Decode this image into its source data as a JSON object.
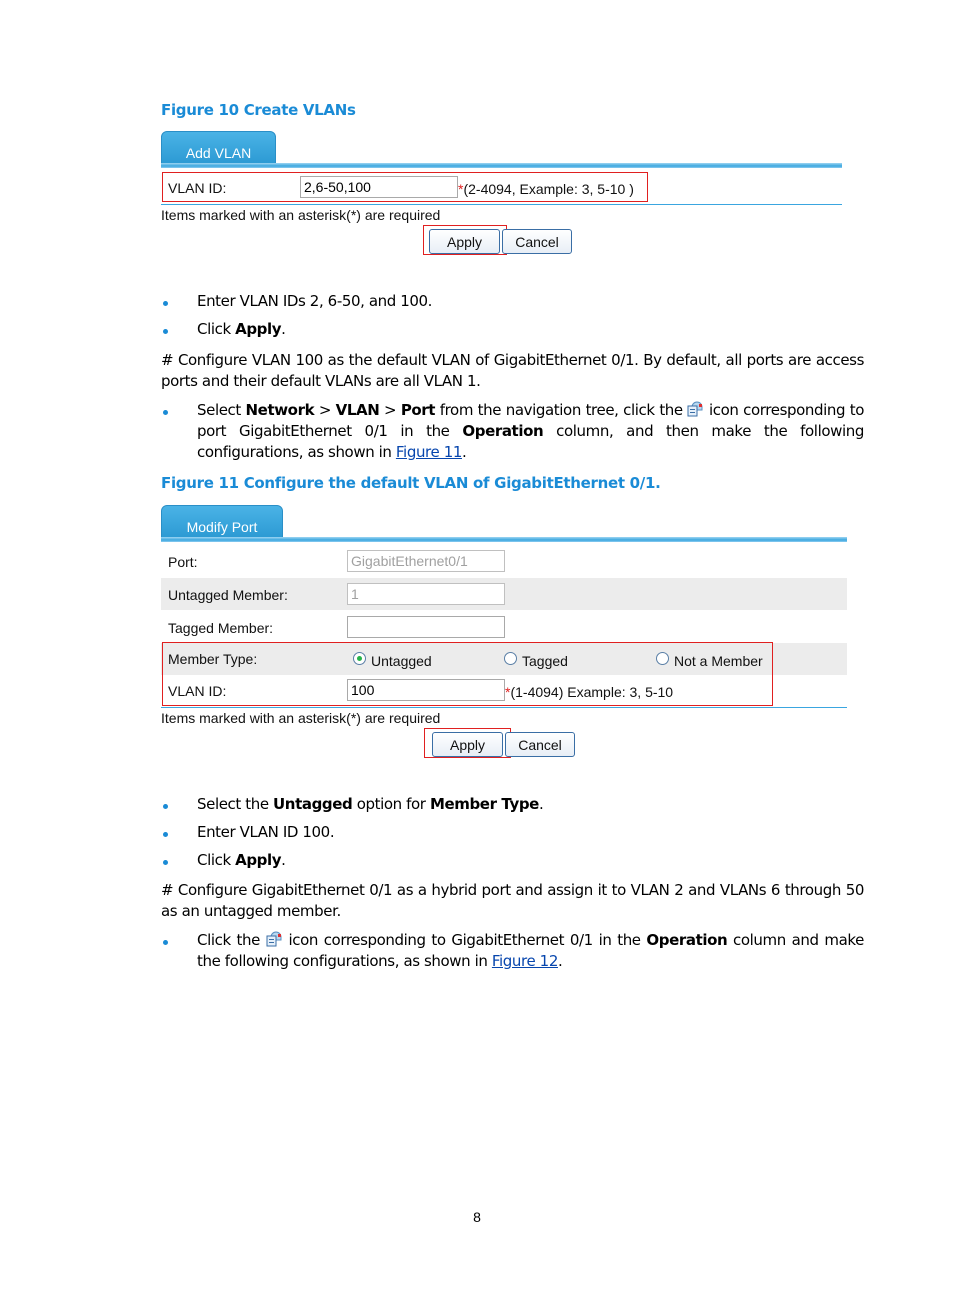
{
  "figure10": {
    "caption": "Figure 10 Create VLANs",
    "tab_label": "Add VLAN",
    "vlan_id_label": "VLAN ID:",
    "vlan_id_value": "2,6-50,100",
    "vlan_id_hint_asterisk": "*",
    "vlan_id_hint": "(2-4094, Example: 3, 5-10 )",
    "required_note": "Items marked with an asterisk(*) are required",
    "apply_label": "Apply",
    "cancel_label": "Cancel"
  },
  "steps1": [
    {
      "text": "Enter VLAN IDs 2, 6-50, and 100."
    },
    {
      "pre": "Click ",
      "bold": "Apply",
      "post": "."
    }
  ],
  "para1": "# Configure VLAN 100 as the default VLAN of GigabitEthernet 0/1. By default, all ports are access ports and their default VLANs are all VLAN 1.",
  "step_select": {
    "t1": "Select ",
    "b1": "Network",
    "t2": " > ",
    "b2": "VLAN",
    "t3": " > ",
    "b3": "Port",
    "t4": " from the navigation tree, click the ",
    "icon": "port-operation-icon",
    "t5": " icon corresponding to port GigabitEthernet 0/1 in the ",
    "b4": "Operation",
    "t6": " column, and then make the following configurations, as shown in ",
    "link": "Figure 11",
    "t7": "."
  },
  "figure11": {
    "caption": "Figure 11 Configure the default VLAN of GigabitEthernet 0/1.",
    "tab_label": "Modify Port",
    "port_label": "Port:",
    "port_value": "GigabitEthernet0/1",
    "untagged_label": "Untagged Member:",
    "untagged_value": "1",
    "tagged_label": "Tagged Member:",
    "tagged_value": "",
    "member_type_label": "Member Type:",
    "member_type_options": [
      {
        "label": "Untagged",
        "checked": true
      },
      {
        "label": "Tagged",
        "checked": false
      },
      {
        "label": "Not a Member",
        "checked": false
      }
    ],
    "vlan_id_label": "VLAN ID:",
    "vlan_id_value": "100",
    "vlan_id_hint_asterisk": "*",
    "vlan_id_hint": "(1-4094) Example: 3, 5-10",
    "required_note": "Items marked with an asterisk(*) are required",
    "apply_label": "Apply",
    "cancel_label": "Cancel"
  },
  "steps2": [
    {
      "pre": "Select the ",
      "bold": "Untagged",
      "mid": " option for ",
      "bold2": "Member Type",
      "post": "."
    },
    {
      "text": "Enter VLAN ID 100."
    },
    {
      "pre": "Click ",
      "bold": "Apply",
      "post": "."
    }
  ],
  "para2": "# Configure GigabitEthernet 0/1 as a hybrid port and assign it to VLAN 2 and VLANs 6 through 50 as an untagged member.",
  "step_click": {
    "t1": "Click the ",
    "icon": "port-operation-icon",
    "t2": " icon corresponding to GigabitEthernet 0/1 in the ",
    "b1": "Operation",
    "t3": " column and make the following configurations, as shown in ",
    "link": "Figure 12",
    "t4": "."
  },
  "page_number": "8",
  "colors": {
    "accent": "#1a8bd6",
    "highlight_box": "#e02020",
    "tab_blue": "#2a98d2"
  }
}
